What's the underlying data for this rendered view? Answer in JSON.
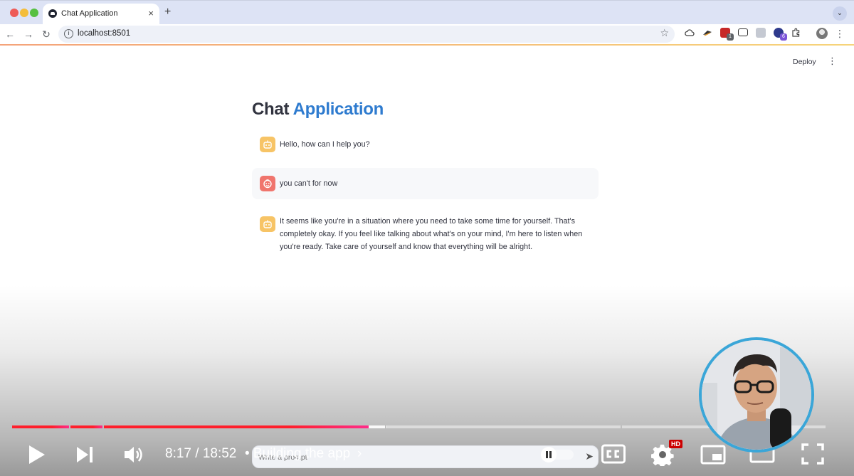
{
  "browser": {
    "tab_title": "Chat Application",
    "tab_close": "×",
    "new_tab": "+",
    "url": "localhost:8501",
    "extension_badges": [
      "1",
      "6"
    ]
  },
  "app": {
    "deploy_label": "Deploy",
    "title_plain": "Chat",
    "title_accent": "Application",
    "messages": [
      {
        "role": "assistant",
        "text": "Hello, how can I help you?"
      },
      {
        "role": "user",
        "text": "you can't for now"
      },
      {
        "role": "assistant",
        "text": "It seems like you're in a situation where you need to take some time for yourself. That's completely okay. If you feel like talking about what's on your mind, I'm here to listen when you're ready. Take care of yourself and know that everything will be alright."
      }
    ],
    "chat_input_placeholder": "Write a prompt"
  },
  "player": {
    "current_time": "8:17",
    "duration": "18:52",
    "time_display": "8:17 / 18:52",
    "chapter": "• Building the app",
    "chapter_chevron": "›",
    "hd_badge": "HD",
    "cc_label": "CC",
    "progress_played_fraction": 0.4386,
    "progress_buffered_fraction": 0.4606,
    "autoplay_on": true
  },
  "colors": {
    "streamlit_accent": "#2e7bcf",
    "assistant_avatar": "#f7c466",
    "user_avatar": "#f0756d",
    "progress_red": "#ff1f2c",
    "webcam_ring": "#3aa6d8"
  }
}
